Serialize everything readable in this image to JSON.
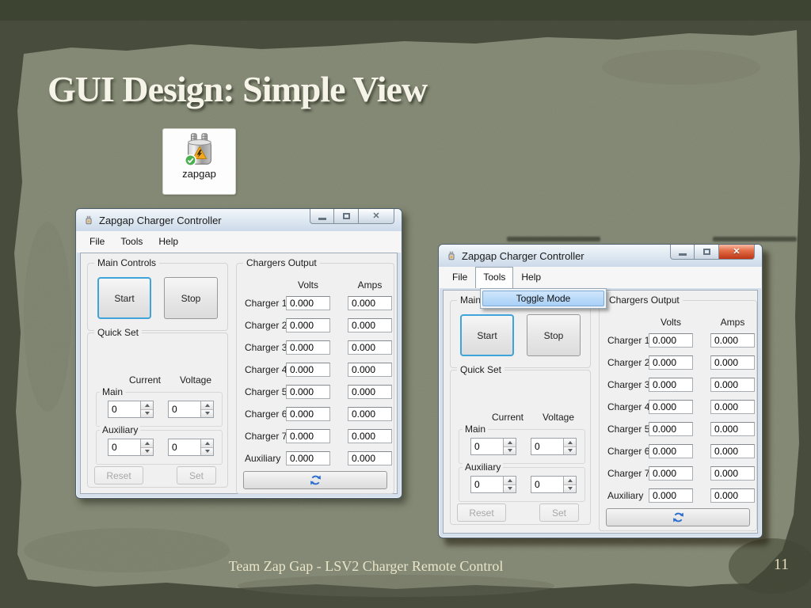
{
  "slide": {
    "title": "GUI Design: Simple View",
    "footer": "Team Zap Gap - LSV2 Charger Remote Control",
    "page_number": "11"
  },
  "desktop_icon": {
    "label": "zapgap"
  },
  "icons": {
    "close_glyph": "✕"
  },
  "colors": {
    "background_dark": "#4c5140",
    "paper": "#8c917c",
    "title_text": "#f6f4e8",
    "footer_text": "#e9e5c8",
    "focus_border": "#3fa4d9",
    "menu_highlight": "#b9d9fb",
    "close_button_red": "#bd3615",
    "refresh_icon": "#2f6fd0"
  },
  "app": {
    "window_title": "Zapgap Charger Controller",
    "menus": [
      "File",
      "Tools",
      "Help"
    ],
    "main_controls": {
      "label": "Main Controls",
      "start_label": "Start",
      "stop_label": "Stop"
    },
    "quick_set": {
      "label": "Quick Set",
      "current_header": "Current",
      "voltage_header": "Voltage",
      "main_label": "Main",
      "auxiliary_label": "Auxiliary",
      "main_current_value": "0",
      "main_voltage_value": "0",
      "aux_current_value": "0",
      "aux_voltage_value": "0",
      "reset_label": "Reset",
      "set_label": "Set"
    },
    "chargers_output": {
      "label": "Chargers Output",
      "volts_header": "Volts",
      "amps_header": "Amps",
      "rows": [
        {
          "label": "Charger 1",
          "volts": "0.000",
          "amps": "0.000"
        },
        {
          "label": "Charger 2",
          "volts": "0.000",
          "amps": "0.000"
        },
        {
          "label": "Charger 3",
          "volts": "0.000",
          "amps": "0.000"
        },
        {
          "label": "Charger 4",
          "volts": "0.000",
          "amps": "0.000"
        },
        {
          "label": "Charger 5",
          "volts": "0.000",
          "amps": "0.000"
        },
        {
          "label": "Charger 6",
          "volts": "0.000",
          "amps": "0.000"
        },
        {
          "label": "Charger 7",
          "volts": "0.000",
          "amps": "0.000"
        },
        {
          "label": "Auxiliary",
          "volts": "0.000",
          "amps": "0.000"
        }
      ]
    },
    "tools_menu": {
      "items": [
        "Toggle Mode"
      ]
    }
  }
}
